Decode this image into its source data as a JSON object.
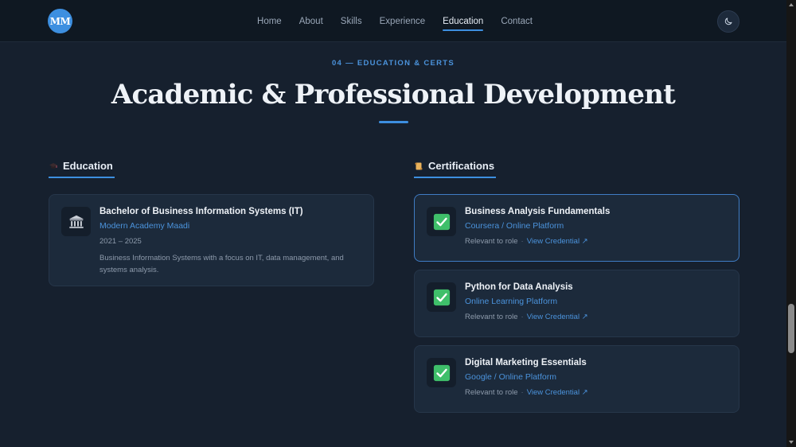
{
  "header": {
    "logo_text": "MM",
    "nav": [
      {
        "label": "Home"
      },
      {
        "label": "About"
      },
      {
        "label": "Skills"
      },
      {
        "label": "Experience"
      },
      {
        "label": "Education",
        "active": true
      },
      {
        "label": "Contact"
      }
    ],
    "theme_icon": "moon-icon"
  },
  "section": {
    "eyebrow": "04 — EDUCATION & CERTS",
    "title": "Academic & Professional Development"
  },
  "education": {
    "heading": "Education",
    "heading_icon": "graduation-cap-icon",
    "items": [
      {
        "icon": "classical-building-icon",
        "title": "Bachelor of Business Information Systems (IT)",
        "institution": "Modern Academy Maadi",
        "years": "2021 – 2025",
        "description": "Business Information Systems with a focus on IT, data management, and systems analysis."
      }
    ]
  },
  "certifications": {
    "heading": "Certifications",
    "heading_icon": "scroll-icon",
    "items": [
      {
        "icon": "check-mark-icon",
        "title": "Business Analysis Fundamentals",
        "provider": "Coursera / Online Platform",
        "relevance": "Relevant to role",
        "separator": "·",
        "link": "View Credential ↗"
      },
      {
        "icon": "check-mark-icon",
        "title": "Python for Data Analysis",
        "provider": "Online Learning Platform",
        "relevance": "Relevant to role",
        "separator": "·",
        "link": "View Credential ↗"
      },
      {
        "icon": "check-mark-icon",
        "title": "Digital Marketing Essentials",
        "provider": "Google / Online Platform",
        "relevance": "Relevant to role",
        "separator": "·",
        "link": "View Credential ↗"
      }
    ]
  },
  "colors": {
    "accent": "#3d8fe0",
    "background": "#16202e",
    "card": "#1c2a3b",
    "check": "#3fbf6a"
  }
}
